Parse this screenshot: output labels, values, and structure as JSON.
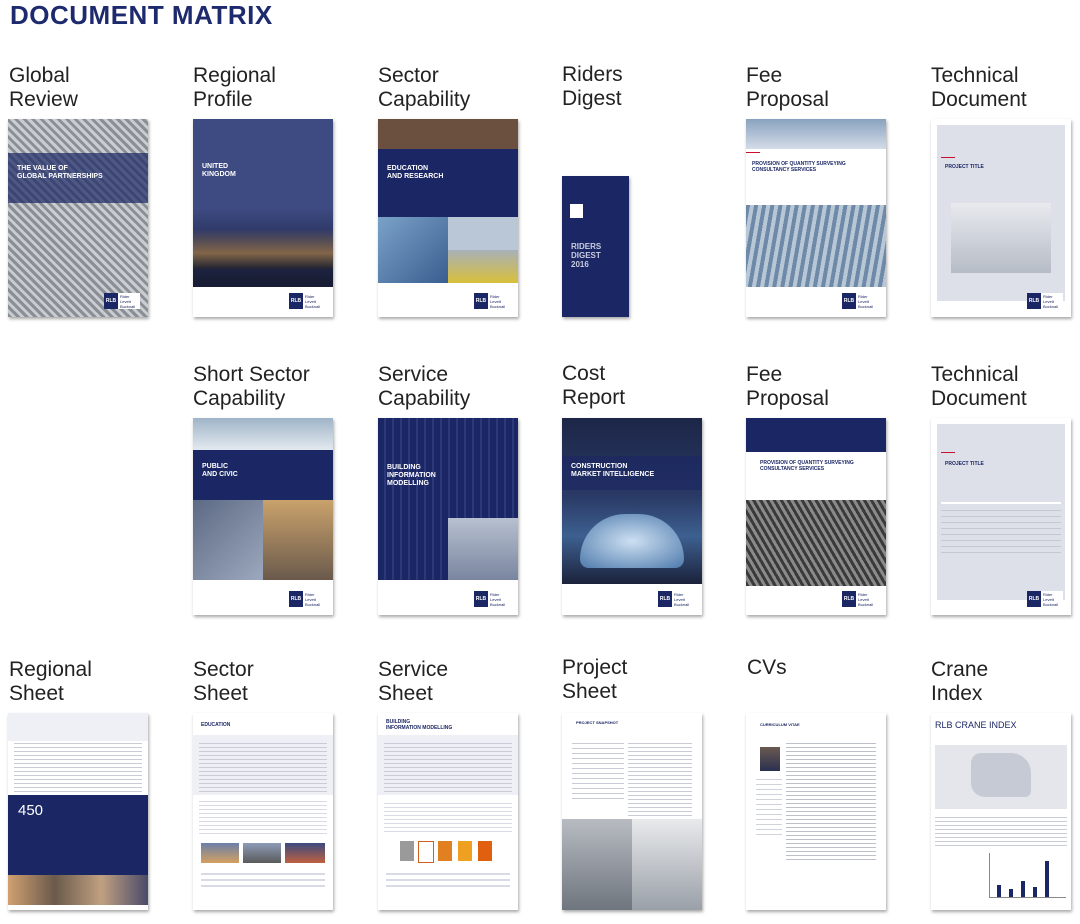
{
  "page_title": "DOCUMENT MATRIX",
  "logo": {
    "mark": "RLB",
    "name": "Rider\nLevett\nBucknall"
  },
  "rows": [
    [
      {
        "label": "Global\nReview",
        "cover_text": "THE VALUE OF\nGLOBAL PARTNERSHIPS"
      },
      {
        "label": "Regional\nProfile",
        "cover_text": "UNITED\nKINGDOM"
      },
      {
        "label": "Sector\nCapability",
        "cover_text": "EDUCATION\nAND RESEARCH"
      },
      {
        "label": "Riders\nDigest",
        "cover_text": "RIDERS\nDIGEST\n2016"
      },
      {
        "label": "Fee\nProposal",
        "cover_text": "PROVISION OF QUANTITY SURVEYING\nCONSULTANCY SERVICES"
      },
      {
        "label": "Technical\nDocument",
        "cover_text": "PROJECT TITLE"
      }
    ],
    [
      {
        "label": "",
        "cover_text": ""
      },
      {
        "label": "Short Sector\nCapability",
        "cover_text": "PUBLIC\nAND CIVIC"
      },
      {
        "label": "Service\nCapability",
        "cover_text": "BUILDING\nINFORMATION\nMODELLING"
      },
      {
        "label": "Cost\nReport",
        "cover_text": "CONSTRUCTION\nMARKET INTELLIGENCE"
      },
      {
        "label": "Fee\nProposal",
        "cover_text": "PROVISION OF QUANTITY SURVEYING\nCONSULTANCY SERVICES"
      },
      {
        "label": "Technical\nDocument",
        "cover_text": "PROJECT TITLE"
      }
    ],
    [
      {
        "label": "Regional\nSheet",
        "cover_text": "450"
      },
      {
        "label": "Sector\nSheet",
        "cover_text": "EDUCATION"
      },
      {
        "label": "Service\nSheet",
        "cover_text": "BUILDING\nINFORMATION MODELLING"
      },
      {
        "label": "Project\nSheet",
        "cover_text": "PROJECT SNAPSHOT"
      },
      {
        "label": "CVs",
        "cover_text": "CURRICULUM VITAE"
      },
      {
        "label": "Crane\nIndex",
        "cover_text": "RLB CRANE INDEX"
      }
    ]
  ]
}
